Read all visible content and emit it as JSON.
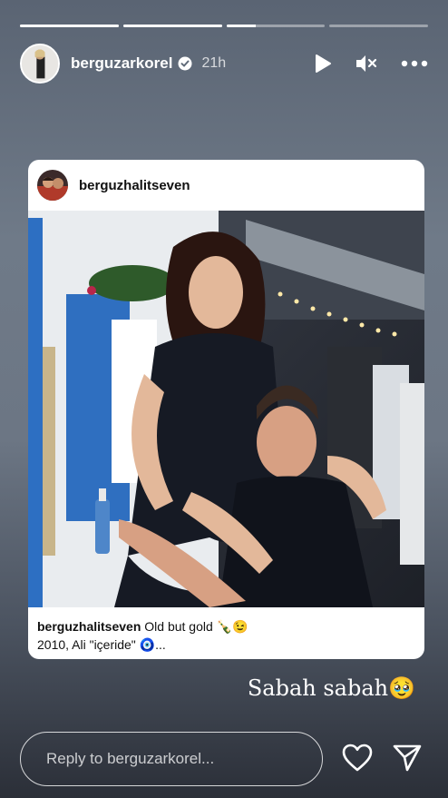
{
  "story": {
    "progress_segments": [
      1.0,
      1.0,
      0.3,
      0.0
    ],
    "username": "berguzarkorel",
    "time_ago": "21h",
    "icons": [
      "play-icon",
      "muted-speaker-icon",
      "more-options-icon"
    ]
  },
  "shared_post": {
    "username": "berguzhalitseven",
    "caption_username": "berguzhalitseven",
    "caption_line1": "Old but gold 🍾😉",
    "caption_line2": "2010, Ali \"içeride\" 🧿..."
  },
  "overlay_text": "Sabah sabah🥹",
  "reply": {
    "placeholder": "Reply to berguzarkorel..."
  },
  "actions": {
    "icons": [
      "heart-icon",
      "send-icon"
    ]
  }
}
